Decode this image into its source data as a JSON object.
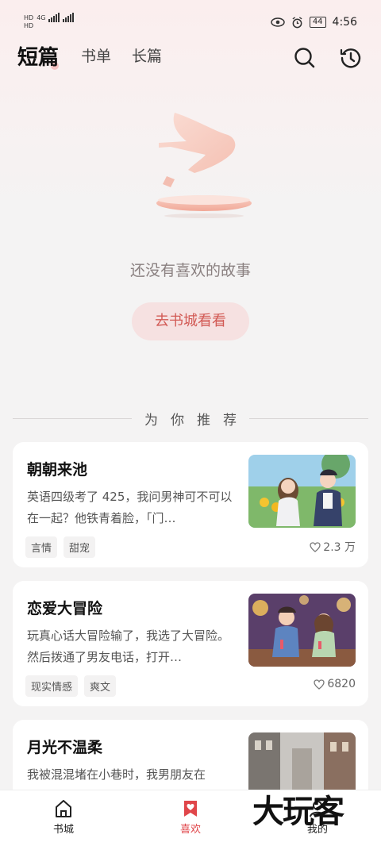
{
  "status_bar": {
    "left_top": "HD",
    "left_bottom": "HD",
    "signal": "4G",
    "battery": "44",
    "time": "4:56"
  },
  "header": {
    "tabs": [
      "短篇",
      "书单",
      "长篇"
    ]
  },
  "empty_state": {
    "message": "还没有喜欢的故事",
    "button": "去书城看看"
  },
  "recommend": {
    "label": "为你推荐"
  },
  "cards": [
    {
      "title": "朝朝来池",
      "desc": "英语四级考了 425，我问男神可不可以在一起？他铁青着脸，「门…",
      "tags": [
        "言情",
        "甜宠"
      ],
      "likes": "2.3 万"
    },
    {
      "title": "恋爱大冒险",
      "desc": "玩真心话大冒险输了，我选了大冒险。然后拨通了男友电话，打开…",
      "tags": [
        "现实情感",
        "爽文"
      ],
      "likes": "6820"
    },
    {
      "title": "月光不温柔",
      "desc": "我被混混堵在小巷时，我男朋友在",
      "tags": [],
      "likes": ""
    }
  ],
  "bottom_nav": {
    "items": [
      "书城",
      "喜欢",
      "我的"
    ]
  },
  "watermark": "大玩客",
  "colors": {
    "accent": "#e0464a",
    "button_bg": "#f6e1e1"
  }
}
